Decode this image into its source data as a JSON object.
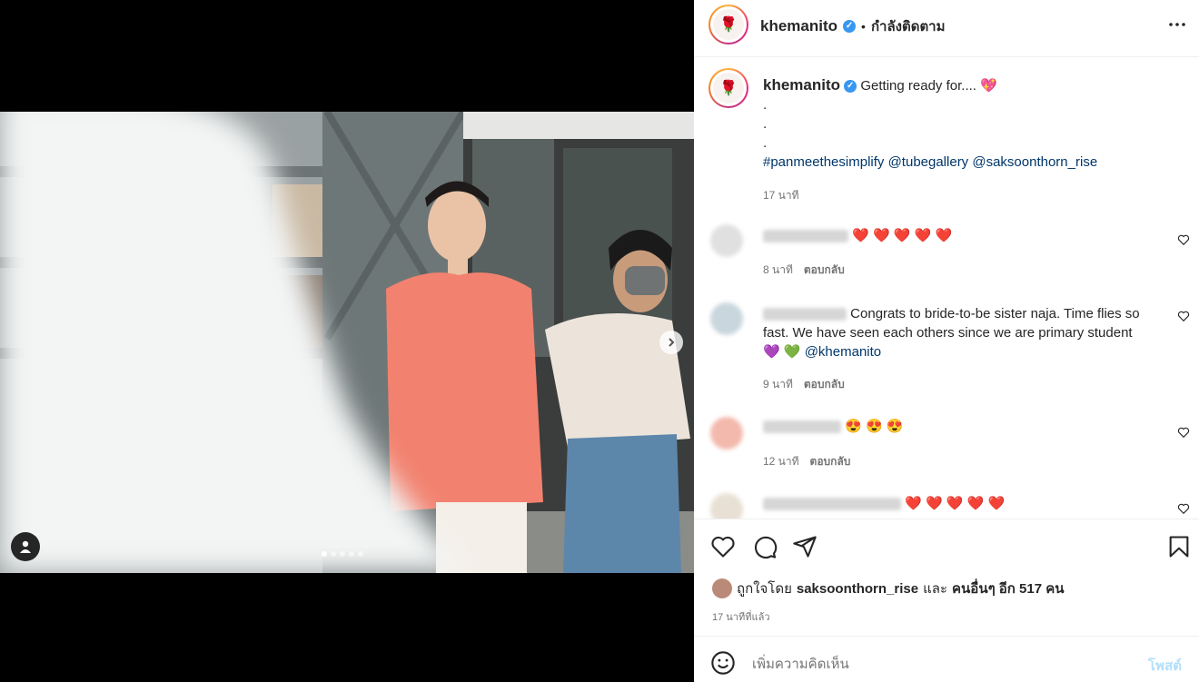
{
  "post": {
    "username": "khemanito",
    "follow_status": "กำลังติดตาม",
    "separator": "•",
    "caption": "Getting ready for.... 💖",
    "caption_dots": [
      ".",
      ".",
      "."
    ],
    "hashtags": "#panmeethesimplify",
    "mentions": [
      "@tubegallery",
      "@saksoonthorn_rise"
    ],
    "caption_time": "17 นาที"
  },
  "comments": [
    {
      "username": "phonthipist",
      "text": "❤️ ❤️ ❤️ ❤️ ❤️",
      "time": "8 นาที",
      "reply": "ตอบกลับ"
    },
    {
      "username": "onranchana",
      "text": "Congrats to bride-to-be sister naja. Time flies so fast. We have seen each others since we are primary student",
      "emoji": "💜 💚",
      "mention": "@khemanito",
      "time": "9 นาที",
      "reply": "ตอบกลับ"
    },
    {
      "username": "moodactiv",
      "text": "😍 😍 😍",
      "time": "12 นาที",
      "reply": "ตอบกลับ"
    },
    {
      "username": "perfumes_memory",
      "text": "❤️ ❤️ ❤️ ❤️ ❤️"
    }
  ],
  "likes": {
    "prefix": "ถูกใจโดย",
    "user": "saksoonthorn_rise",
    "middle": "และ",
    "others": "คนอื่นๆ อีก 517 คน"
  },
  "post_time": "17 นาทีที่แล้ว",
  "comment_box": {
    "placeholder": "เพิ่มความคิดเห็น",
    "post_label": "โพสต์"
  },
  "carousel": {
    "count": 5,
    "active": 0
  },
  "colors": {
    "link": "#00376b",
    "post_button": "#b2dffc",
    "verified": "#3897f0",
    "blazer": "#f2826f"
  },
  "icons": [
    "more-icon",
    "heart-icon",
    "comment-icon",
    "share-icon",
    "bookmark-icon",
    "emoji-icon",
    "next-icon",
    "user-tag-icon"
  ]
}
